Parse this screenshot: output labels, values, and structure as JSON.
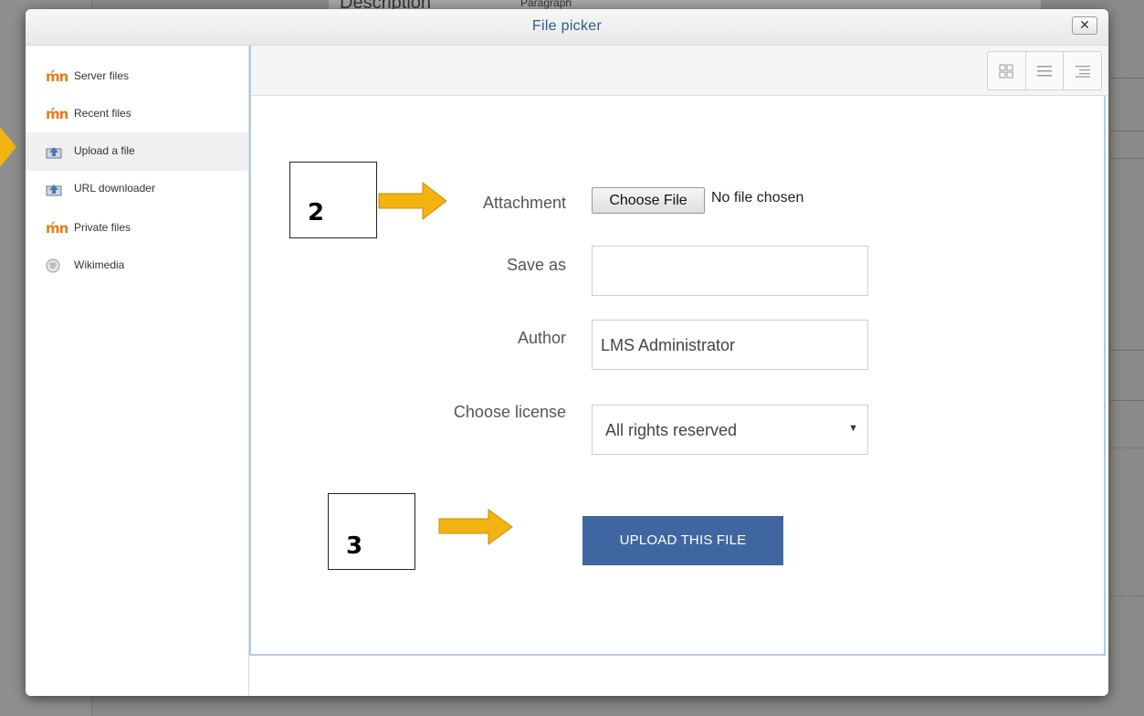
{
  "background": {
    "description_label": "Description",
    "paragraph_label": "Paragraph"
  },
  "dialog": {
    "title": "File picker",
    "close_label": "✕"
  },
  "sidebar": {
    "items": [
      {
        "label": "Server files",
        "icon": "moodle-icon"
      },
      {
        "label": "Recent files",
        "icon": "moodle-icon"
      },
      {
        "label": "Upload a file",
        "icon": "upload-icon",
        "active": true
      },
      {
        "label": "URL downloader",
        "icon": "url-download-icon"
      },
      {
        "label": "Private files",
        "icon": "moodle-icon"
      },
      {
        "label": "Wikimedia",
        "icon": "wikimedia-icon"
      }
    ]
  },
  "toolbar": {
    "views": [
      "icons-view",
      "list-view",
      "tree-view"
    ]
  },
  "form": {
    "attachment_label": "Attachment",
    "choose_file_label": "Choose File",
    "no_file_text": "No file chosen",
    "save_as_label": "Save as",
    "save_as_value": "",
    "author_label": "Author",
    "author_value": "LMS Administrator",
    "license_label": "Choose license",
    "license_value": "All rights reserved",
    "upload_button": "UPLOAD THIS FILE"
  },
  "annotations": {
    "step2": "2",
    "step3": "3"
  },
  "colors": {
    "accent_arrow": "#f3b311",
    "upload_button": "#3f66a0",
    "title_text": "#2e5a8a"
  }
}
